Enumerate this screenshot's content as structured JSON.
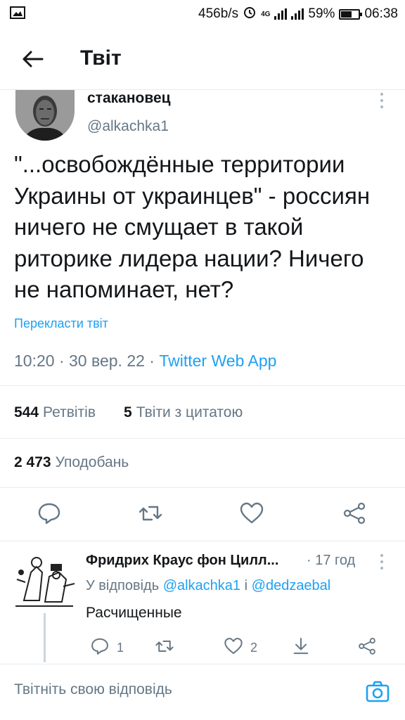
{
  "status_bar": {
    "net_speed": "456b/s",
    "network": "4G",
    "battery": "59%",
    "battery_level": 0.59,
    "time": "06:38"
  },
  "header": {
    "title": "Твіт"
  },
  "tweet": {
    "author_name": "стакановец",
    "author_handle": "@alkachka1",
    "text": "\"...освобождённые территории Украины от украинцев\" - россиян ничего не смущает в такой риторике лидера нации? Ничего не напоминает, нет?",
    "translate_label": "Перекласти твіт",
    "time": "10:20",
    "date": "30 вер. 22",
    "source": "Twitter Web App",
    "retweets_count": "544",
    "retweets_label": "Ретвітів",
    "quotes_count": "5",
    "quotes_label": "Твіти з цитатою",
    "likes_count": "2 473",
    "likes_label": "Уподобань"
  },
  "reply": {
    "author_name": "Фридрих Краус фон Цилл...",
    "time": "17 год",
    "reply_to_label": "У відповідь",
    "mention_1": "@alkachka1",
    "conjunction": "і",
    "mention_2": "@dedzaebal",
    "text": "Расчищенные",
    "reply_count": "1",
    "like_count": "2"
  },
  "compose": {
    "placeholder": "Твітніть свою відповідь"
  },
  "colors": {
    "accent": "#1da1f2",
    "secondary_text": "#657786",
    "divider": "#e6ecf0"
  },
  "icons": [
    "gallery-icon",
    "alarm-icon",
    "signal-icon",
    "battery-icon",
    "back-arrow-icon",
    "more-icon",
    "reply-icon",
    "retweet-icon",
    "like-icon",
    "share-icon",
    "download-icon",
    "camera-icon"
  ]
}
